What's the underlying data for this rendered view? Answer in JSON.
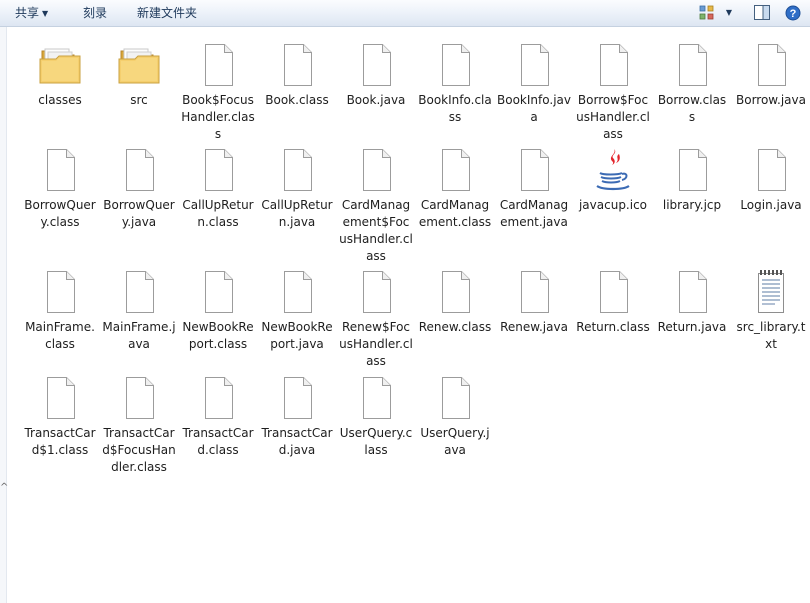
{
  "toolbar": {
    "share_label": "共享",
    "burn_label": "刻录",
    "new_folder_label": "新建文件夹",
    "views_icon": "change-view-icon",
    "preview_icon": "preview-pane-icon"
  },
  "files": [
    {
      "name": "classes",
      "type": "folder"
    },
    {
      "name": "src",
      "type": "folder"
    },
    {
      "name": "Book$FocusHandler.class",
      "type": "file"
    },
    {
      "name": "Book.class",
      "type": "file"
    },
    {
      "name": "Book.java",
      "type": "file"
    },
    {
      "name": "BookInfo.class",
      "type": "file"
    },
    {
      "name": "BookInfo.java",
      "type": "file"
    },
    {
      "name": "Borrow$FocusHandler.class",
      "type": "file"
    },
    {
      "name": "Borrow.class",
      "type": "file"
    },
    {
      "name": "Borrow.java",
      "type": "file"
    },
    {
      "name": "BorrowQuery.class",
      "type": "file"
    },
    {
      "name": "BorrowQuery.java",
      "type": "file"
    },
    {
      "name": "CallUpReturn.class",
      "type": "file"
    },
    {
      "name": "CallUpReturn.java",
      "type": "file"
    },
    {
      "name": "CardManagement$FocusHandler.class",
      "type": "file"
    },
    {
      "name": "CardManagement.class",
      "type": "file"
    },
    {
      "name": "CardManagement.java",
      "type": "file"
    },
    {
      "name": "javacup.ico",
      "type": "java"
    },
    {
      "name": "library.jcp",
      "type": "file"
    },
    {
      "name": "Login.java",
      "type": "file"
    },
    {
      "name": "MainFrame.class",
      "type": "file"
    },
    {
      "name": "MainFrame.java",
      "type": "file"
    },
    {
      "name": "NewBookReport.class",
      "type": "file"
    },
    {
      "name": "NewBookReport.java",
      "type": "file"
    },
    {
      "name": "Renew$FocusHandler.class",
      "type": "file"
    },
    {
      "name": "Renew.class",
      "type": "file"
    },
    {
      "name": "Renew.java",
      "type": "file"
    },
    {
      "name": "Return.class",
      "type": "file"
    },
    {
      "name": "Return.java",
      "type": "file"
    },
    {
      "name": "src_library.txt",
      "type": "text"
    },
    {
      "name": "TransactCard$1.class",
      "type": "file"
    },
    {
      "name": "TransactCard$FocusHandler.class",
      "type": "file"
    },
    {
      "name": "TransactCard.class",
      "type": "file"
    },
    {
      "name": "TransactCard.java",
      "type": "file"
    },
    {
      "name": "UserQuery.class",
      "type": "file"
    },
    {
      "name": "UserQuery.java",
      "type": "file"
    }
  ]
}
